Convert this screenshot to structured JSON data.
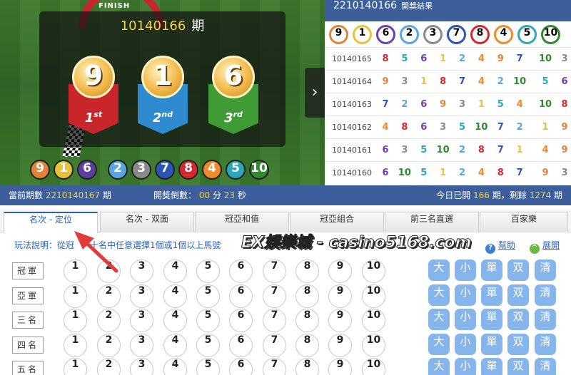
{
  "race": {
    "finish_label": "FINISH",
    "period": "10140166",
    "period_suffix": "期",
    "podium": [
      {
        "number": "9",
        "place": "1",
        "place_suffix": "st",
        "color": "#c8262b"
      },
      {
        "number": "1",
        "place": "2",
        "place_suffix": "nd",
        "color": "#2f8bd0"
      },
      {
        "number": "6",
        "place": "3",
        "place_suffix": "rd",
        "color": "#3f9b33"
      }
    ],
    "result_balls": [
      {
        "n": "9",
        "color": "#e3833a"
      },
      {
        "n": "1",
        "color": "#e7c23b"
      },
      {
        "n": "6",
        "color": "#5d3fa0"
      },
      {
        "n": "2",
        "color": "#5aa6e0"
      },
      {
        "n": "3",
        "color": "#8a8a8a"
      },
      {
        "n": "7",
        "color": "#2a55b8"
      },
      {
        "n": "8",
        "color": "#d7282f"
      },
      {
        "n": "4",
        "color": "#f08a2b"
      },
      {
        "n": "5",
        "color": "#2aa8b8"
      },
      {
        "n": "10",
        "color": "#2f8b2f"
      }
    ],
    "next_arrow": "›"
  },
  "results": {
    "title": "2210140166",
    "subtitle": "開獎結果",
    "header_balls": [
      {
        "n": "9",
        "color": "#e3833a"
      },
      {
        "n": "1",
        "color": "#e7c23b"
      },
      {
        "n": "6",
        "color": "#6a3fb0"
      },
      {
        "n": "2",
        "color": "#5aa6e0"
      },
      {
        "n": "3",
        "color": "#8a8a8a"
      },
      {
        "n": "7",
        "color": "#2a55b8"
      },
      {
        "n": "8",
        "color": "#d7282f"
      },
      {
        "n": "4",
        "color": "#f08a2b"
      },
      {
        "n": "5",
        "color": "#2aa8b8"
      },
      {
        "n": "10",
        "color": "#2f8b2f"
      }
    ],
    "rows": [
      {
        "id": "10140165",
        "nums": [
          "8",
          "5",
          "6",
          "1",
          "2",
          "4",
          "9",
          "7",
          "10",
          "3"
        ]
      },
      {
        "id": "10140164",
        "nums": [
          "9",
          "3",
          "1",
          "8",
          "7",
          "4",
          "2",
          "10",
          "5",
          "6"
        ]
      },
      {
        "id": "10140163",
        "nums": [
          "7",
          "2",
          "6",
          "9",
          "3",
          "1",
          "5",
          "4",
          "10",
          "8"
        ]
      },
      {
        "id": "10140162",
        "nums": [
          "4",
          "8",
          "6",
          "3",
          "5",
          "10",
          "7",
          "2",
          "1",
          "9"
        ]
      },
      {
        "id": "10140161",
        "nums": [
          "6",
          "3",
          "5",
          "10",
          "2",
          "8",
          "7",
          "1",
          "4",
          "9"
        ]
      },
      {
        "id": "10140160",
        "nums": [
          "6",
          "10",
          "5",
          "1",
          "2",
          "4",
          "8",
          "7",
          "9",
          "3"
        ]
      }
    ],
    "num_colors": {
      "1": "#e7c23b",
      "2": "#5aa6e0",
      "3": "#8a8a8a",
      "4": "#f08a2b",
      "5": "#2aa8b8",
      "6": "#6a3fb0",
      "7": "#2a55b8",
      "8": "#d7282f",
      "9": "#e3833a",
      "10": "#2f8b2f"
    }
  },
  "status": {
    "current_label": "當前期數",
    "current_value": "2210140167",
    "current_suffix": "期",
    "countdown_label": "開獎倒數：",
    "minutes": "00",
    "minutes_unit": "分",
    "seconds": "23",
    "seconds_unit": "秒",
    "today_label": "今日已開",
    "today_value": "166",
    "today_unit": "期，剩餘",
    "remaining_value": "1274",
    "remaining_unit": "期"
  },
  "tabs": [
    "名次 - 定位",
    "名次 - 双面",
    "冠亞和值",
    "冠亞組合",
    "前三名直選",
    "百家樂"
  ],
  "info": {
    "text": "玩法說明：從冠",
    "text2": "十名中任意選擇1個或1個以上馬號",
    "help": "幫助",
    "expand": "展開"
  },
  "watermark": "EX娛樂城 - casino5168.com",
  "grid": {
    "rows": [
      "冠軍",
      "亞軍",
      "三名",
      "四名",
      "五名"
    ],
    "numbers": [
      "1",
      "2",
      "3",
      "4",
      "5",
      "6",
      "7",
      "8",
      "9",
      "10"
    ],
    "quick": [
      "大",
      "小",
      "單",
      "双",
      "清"
    ]
  },
  "accent": "#3c5f9c"
}
